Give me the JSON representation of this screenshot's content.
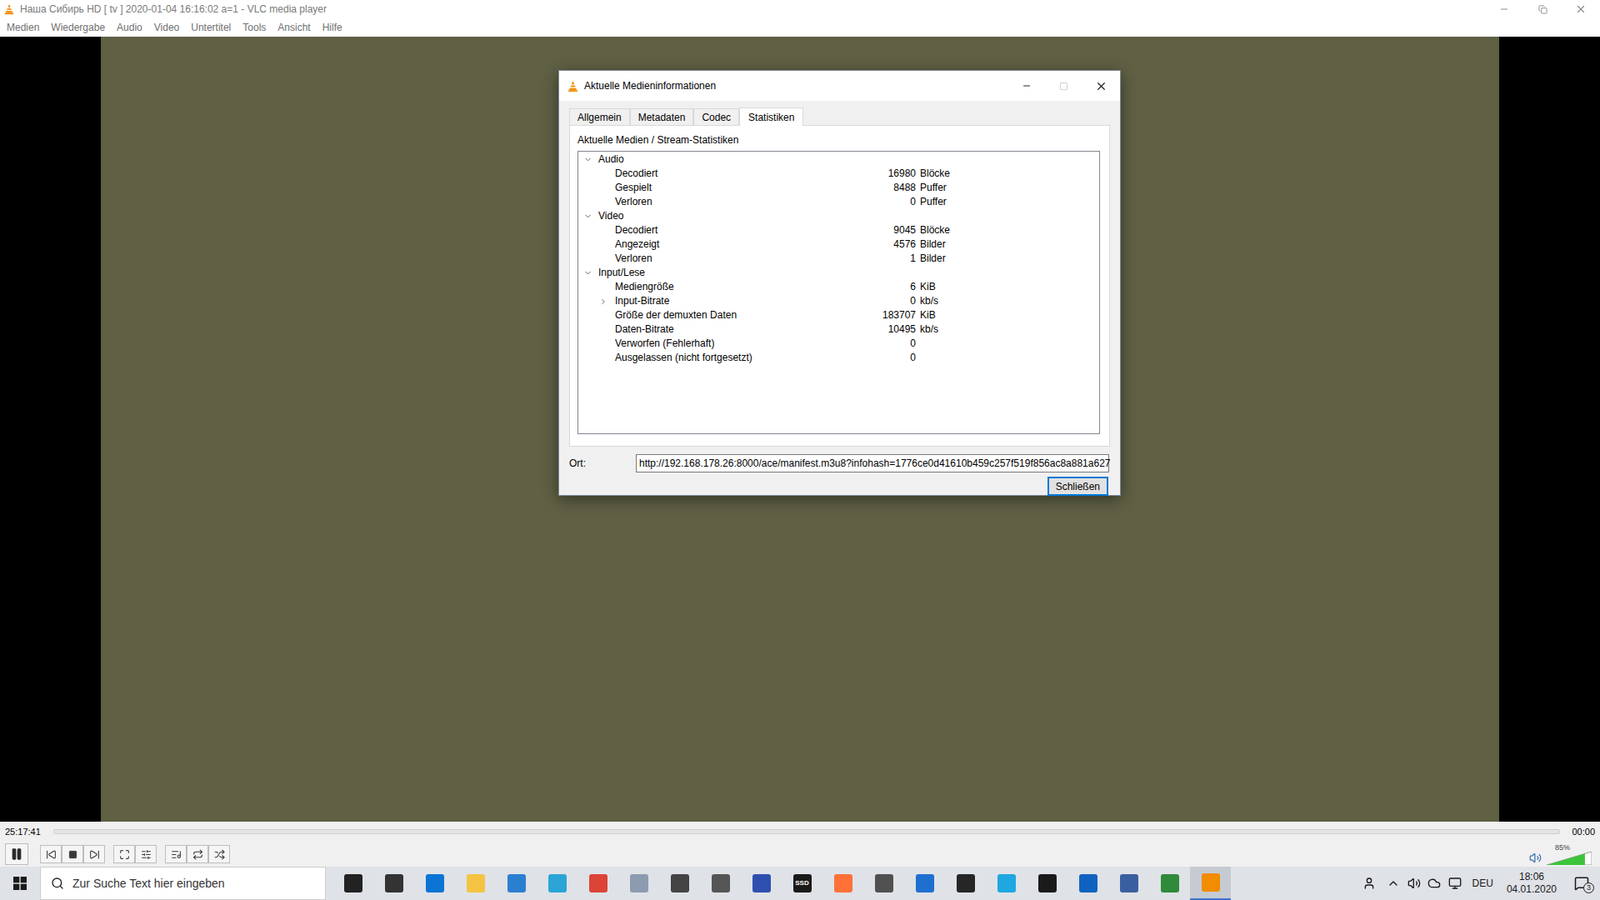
{
  "window": {
    "title": "Наша Сибирь HD [ tv ] 2020-01-04 16:16:02 a=1 - VLC media player"
  },
  "menu": [
    "Medien",
    "Wiedergabe",
    "Audio",
    "Video",
    "Untertitel",
    "Tools",
    "Ansicht",
    "Hilfe"
  ],
  "dialog": {
    "title": "Aktuelle Medieninformationen",
    "maximize_enabled": false,
    "tabs": [
      {
        "label": "Allgemein",
        "selected": false
      },
      {
        "label": "Metadaten",
        "selected": false
      },
      {
        "label": "Codec",
        "selected": false
      },
      {
        "label": "Statistiken",
        "selected": true
      }
    ],
    "heading": "Aktuelle Medien / Stream-Statistiken",
    "groups": [
      {
        "label": "Audio",
        "expanded": true,
        "rows": [
          {
            "label": "Decodiert",
            "value": "16980",
            "unit": "Blöcke",
            "expandable": false,
            "expanded": false
          },
          {
            "label": "Gespielt",
            "value": "8488",
            "unit": "Puffer",
            "expandable": false,
            "expanded": false
          },
          {
            "label": "Verloren",
            "value": "0",
            "unit": "Puffer",
            "expandable": false,
            "expanded": false
          }
        ]
      },
      {
        "label": "Video",
        "expanded": true,
        "rows": [
          {
            "label": "Decodiert",
            "value": "9045",
            "unit": "Blöcke",
            "expandable": false,
            "expanded": false
          },
          {
            "label": "Angezeigt",
            "value": "4576",
            "unit": "Bilder",
            "expandable": false,
            "expanded": false
          },
          {
            "label": "Verloren",
            "value": "1",
            "unit": "Bilder",
            "expandable": false,
            "expanded": false
          }
        ]
      },
      {
        "label": "Input/Lese",
        "expanded": true,
        "rows": [
          {
            "label": "Mediengröße",
            "value": "6",
            "unit": "KiB",
            "expandable": false,
            "expanded": false
          },
          {
            "label": "Input-Bitrate",
            "value": "0",
            "unit": "kb/s",
            "expandable": true,
            "expanded": false
          },
          {
            "label": "Größe der demuxten Daten",
            "value": "183707",
            "unit": "KiB",
            "expandable": false,
            "expanded": false
          },
          {
            "label": "Daten-Bitrate",
            "value": "10495",
            "unit": "kb/s",
            "expandable": false,
            "expanded": false
          },
          {
            "label": "Verworfen (Fehlerhaft)",
            "value": "0",
            "unit": "",
            "expandable": false,
            "expanded": false
          },
          {
            "label": "Ausgelassen (nicht fortgesetzt)",
            "value": "0",
            "unit": "",
            "expandable": false,
            "expanded": false
          }
        ]
      }
    ],
    "location": {
      "label": "Ort:",
      "value": "http://192.168.178.26:8000/ace/manifest.m3u8?infohash=1776ce0d41610b459c257f519f856ac8a881a627"
    },
    "buttons": [
      "Schließen"
    ]
  },
  "player": {
    "elapsed": "25:17:41",
    "remaining": "00:00",
    "seek_level": 0,
    "playing": true,
    "volume": {
      "reading": "85%",
      "level": 0.85
    }
  },
  "taskbar": {
    "search_placeholder": "Zur Suche Text hier eingeben",
    "apps": [
      {
        "color": "#222222",
        "label": "",
        "active": false
      },
      {
        "color": "#333333",
        "label": "",
        "active": false
      },
      {
        "color": "#0a74d4",
        "label": "",
        "active": false
      },
      {
        "color": "#f5c342",
        "label": "",
        "active": false
      },
      {
        "color": "#2b7fd0",
        "label": "",
        "active": false
      },
      {
        "color": "#2aa5d6",
        "label": "",
        "active": false
      },
      {
        "color": "#db4437",
        "label": "",
        "active": false
      },
      {
        "color": "#8c9bb0",
        "label": "",
        "active": false
      },
      {
        "color": "#444444",
        "label": "",
        "active": false
      },
      {
        "color": "#555555",
        "label": "",
        "active": false
      },
      {
        "color": "#2f4fb0",
        "label": "",
        "active": false
      },
      {
        "color": "#1a1a1a",
        "label": "SSD",
        "active": false
      },
      {
        "color": "#ff7139",
        "label": "",
        "active": false
      },
      {
        "color": "#505050",
        "label": "",
        "active": false
      },
      {
        "color": "#1f6fd1",
        "label": "",
        "active": false
      },
      {
        "color": "#262626",
        "label": "",
        "active": false
      },
      {
        "color": "#1ea7e1",
        "label": "",
        "active": false
      },
      {
        "color": "#1a1a1a",
        "label": "",
        "active": false
      },
      {
        "color": "#0f62c0",
        "label": "",
        "active": false
      },
      {
        "color": "#3a5fa0",
        "label": "",
        "active": false
      },
      {
        "color": "#2f8a3a",
        "label": "",
        "active": false
      },
      {
        "color": "#f28c00",
        "label": "",
        "active": true
      }
    ],
    "language": "DEU",
    "time": "18:06",
    "date": "04.01.2020",
    "notifications": "3"
  }
}
